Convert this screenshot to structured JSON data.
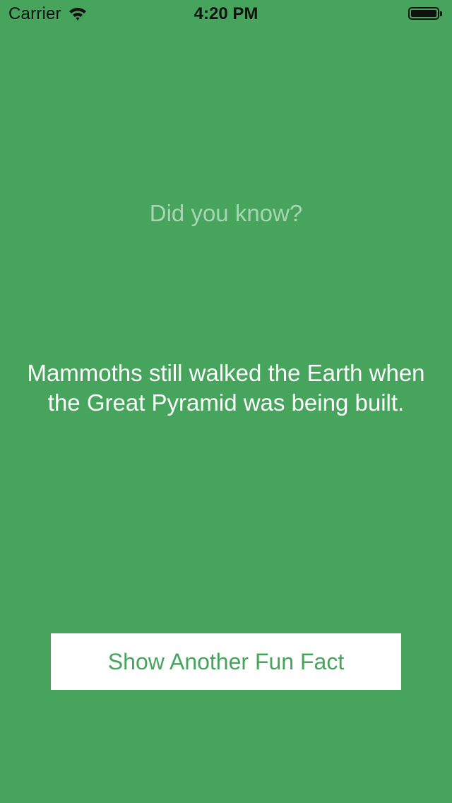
{
  "status_bar": {
    "carrier": "Carrier",
    "time": "4:20 PM",
    "wifi_icon": "wifi-icon",
    "battery_icon": "battery-icon",
    "battery_level": 1.0
  },
  "main": {
    "heading": "Did you know?",
    "fact": "Mammoths still walked the Earth when the Great Pyramid was being built.",
    "button_label": "Show Another Fun Fact"
  },
  "colors": {
    "background": "#47a45c",
    "heading_text": "#a9d5b3",
    "fact_text": "#ffffff",
    "button_background": "#ffffff",
    "button_text": "#47a45c"
  }
}
